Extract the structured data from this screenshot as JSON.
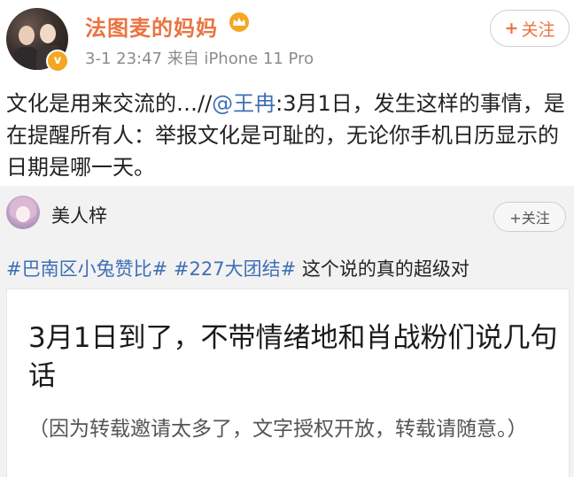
{
  "post": {
    "username": "法图麦的妈妈",
    "meta": "3-1 23:47  来自 iPhone 11 Pro",
    "follow_plus": "+",
    "follow_label": "关注",
    "verified_badge": "v",
    "text_before": "文化是用来交流的…//",
    "mention": "@王冉",
    "text_after": ":3月1日，发生这样的事情，是在提醒所有人：举报文化是可耻的，无论你手机日历显示的日期是哪一天。"
  },
  "repost": {
    "username": "美人梓",
    "follow_label": "+关注",
    "hashtag1": "#巴南区小兔赞比#",
    "hashtag2": "#227大团结#",
    "text": "这个说的真的超级对"
  },
  "article": {
    "title": "3月1日到了，不带情绪地和肖战粉们说几句话",
    "note": "（因为转载邀请太多了，文字授权开放，转载请随意。）"
  },
  "colors": {
    "username": "#eb7340",
    "link": "#3f6fb5",
    "meta": "#8b8b8b",
    "verified": "#f5a623",
    "crown": "#f5a623"
  },
  "icons": {
    "crown": "crown-icon",
    "verified": "verified-badge-icon"
  }
}
